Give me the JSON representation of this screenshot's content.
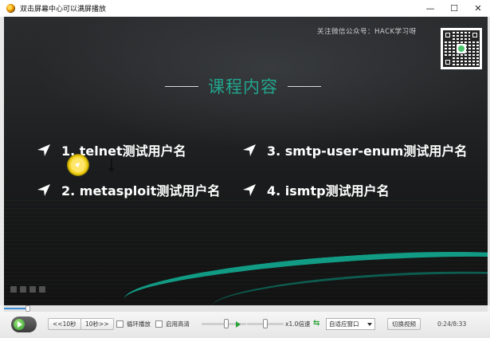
{
  "window": {
    "title": "双击屏幕中心可以满屏播放",
    "controls": {
      "minimize": "—",
      "maximize": "☐",
      "close": "✕"
    }
  },
  "slide": {
    "follow_text": "关注微信公众号：HACK学习呀",
    "heading": "课程内容",
    "items": [
      {
        "label": "1. telnet测试用户名"
      },
      {
        "label": "2. metasploit测试用户名"
      },
      {
        "label": "3. smtp-user-enum测试用户名"
      },
      {
        "label": "4. ismtp测试用户名"
      }
    ],
    "accent_color": "#22a58e"
  },
  "player": {
    "rewind_label": "<<10秒",
    "forward_label": "10秒>>",
    "loop_label": "循环播放",
    "hd_label": "启用高清",
    "speed_label": "x1.0倍速",
    "fit_window_option": "自适应窗口",
    "switch_video_label": "切换视频",
    "time_display": "0:24/8:33",
    "progress": 0.05,
    "volume": 0.55,
    "speed_level": 0.5
  }
}
